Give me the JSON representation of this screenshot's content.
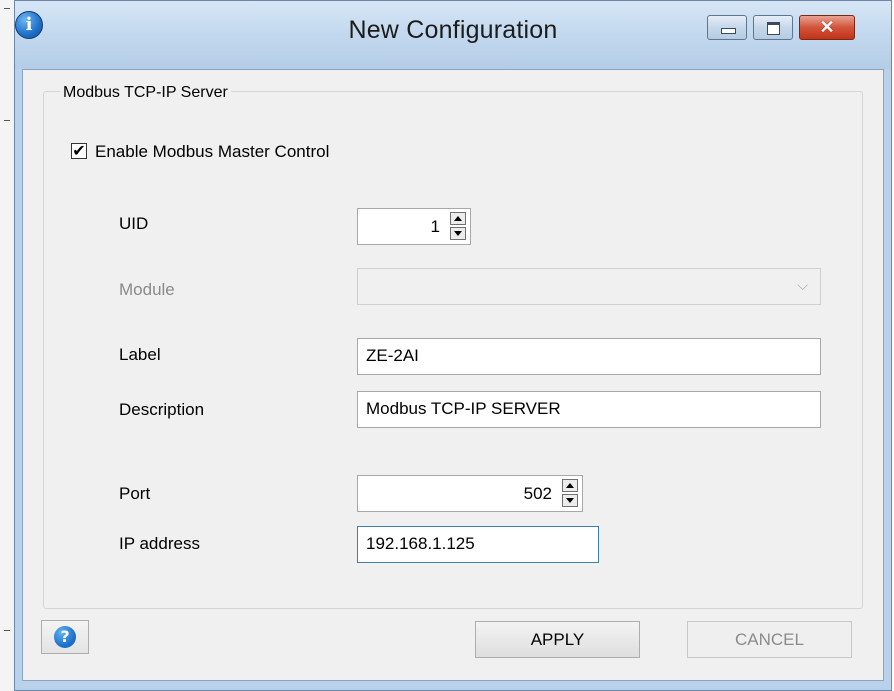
{
  "window": {
    "title": "New Configuration",
    "close_glyph": "✕"
  },
  "icons": {
    "title_icon": "info-icon",
    "help_icon": "help-icon",
    "check_glyph": "✔",
    "chevron_glyph": "⌵"
  },
  "colors": {
    "title_bar": "#c2d8ee",
    "close_button": "#c7482e",
    "focus_border": "#3c7fb1"
  },
  "group": {
    "title": "Modbus TCP-IP Server",
    "enable_checkbox": {
      "label": "Enable Modbus Master Control",
      "checked": true
    }
  },
  "fields": {
    "uid": {
      "label": "UID",
      "value": "1"
    },
    "module": {
      "label": "Module",
      "value": "",
      "enabled": false
    },
    "label": {
      "label": "Label",
      "value": "ZE-2AI"
    },
    "description": {
      "label": "Description",
      "value": "Modbus TCP-IP SERVER"
    },
    "port": {
      "label": "Port",
      "value": "502"
    },
    "ip_address": {
      "label": "IP address",
      "value": "192.168.1.125"
    }
  },
  "buttons": {
    "help": "?",
    "apply": "APPLY",
    "cancel": "CANCEL"
  }
}
